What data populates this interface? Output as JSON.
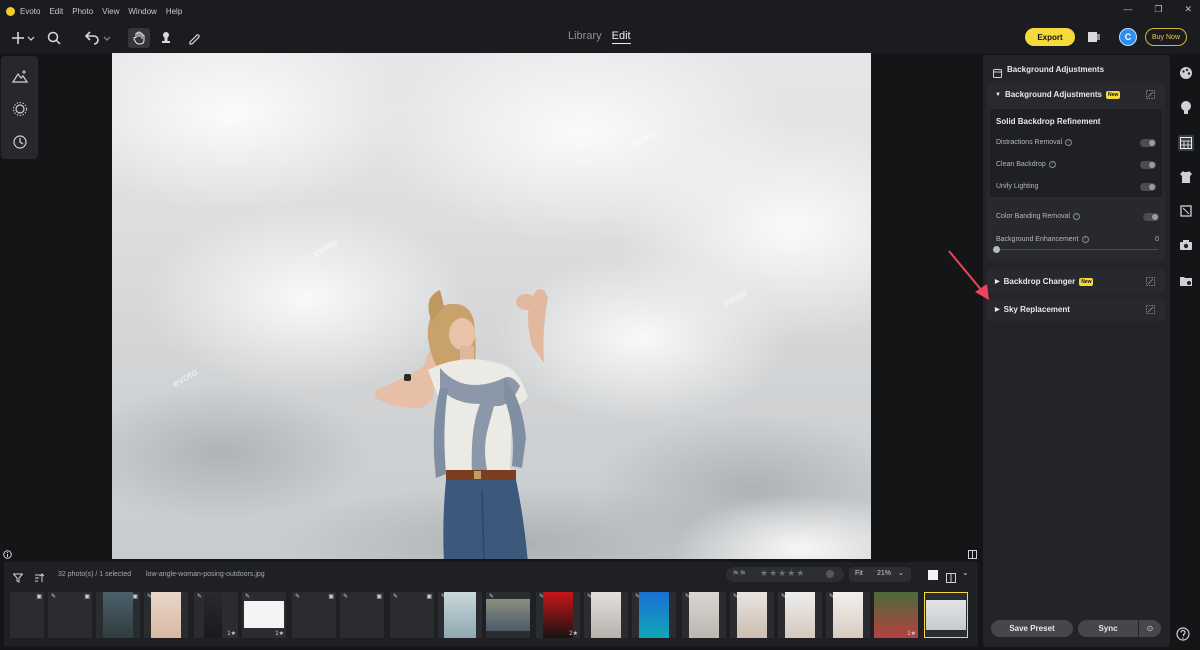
{
  "menubar": {
    "app_name": "Evoto",
    "items": [
      "Edit",
      "Photo",
      "View",
      "Window",
      "Help"
    ],
    "win_min": "—",
    "win_max": "❐",
    "win_close": "✕"
  },
  "toolbar": {
    "tabs": [
      {
        "label": "Library"
      },
      {
        "label": "Edit"
      }
    ],
    "export_label": "Export",
    "avatar_letter": "C",
    "buy_label": "Buy Now"
  },
  "filmbar": {
    "count_text": "32 photo(s) / 1 selected",
    "filename": "low-angle-woman-posing-outdoors.jpg",
    "fit_label": "Fit",
    "zoom": "21%"
  },
  "panel": {
    "title": "Background Adjustments",
    "sections": [
      {
        "label": "Background Adjustments",
        "badge": "New"
      },
      {
        "label": "Backdrop Changer",
        "badge": "New"
      },
      {
        "label": "Sky Replacement"
      }
    ],
    "subheading": "Solid Backdrop Refinement",
    "toggles": [
      {
        "label": "Distractions Removal"
      },
      {
        "label": "Clean Backdrop"
      },
      {
        "label": "Unify Lighting"
      },
      {
        "label": "Color Banding Removal"
      }
    ],
    "slider": {
      "label": "Background Enhancement",
      "value": "0"
    },
    "save_preset": "Save Preset",
    "sync": "Sync"
  },
  "thumb_ratings": [
    "1★",
    "1★",
    "2★",
    "1★"
  ],
  "photo_watermark": "evoto"
}
